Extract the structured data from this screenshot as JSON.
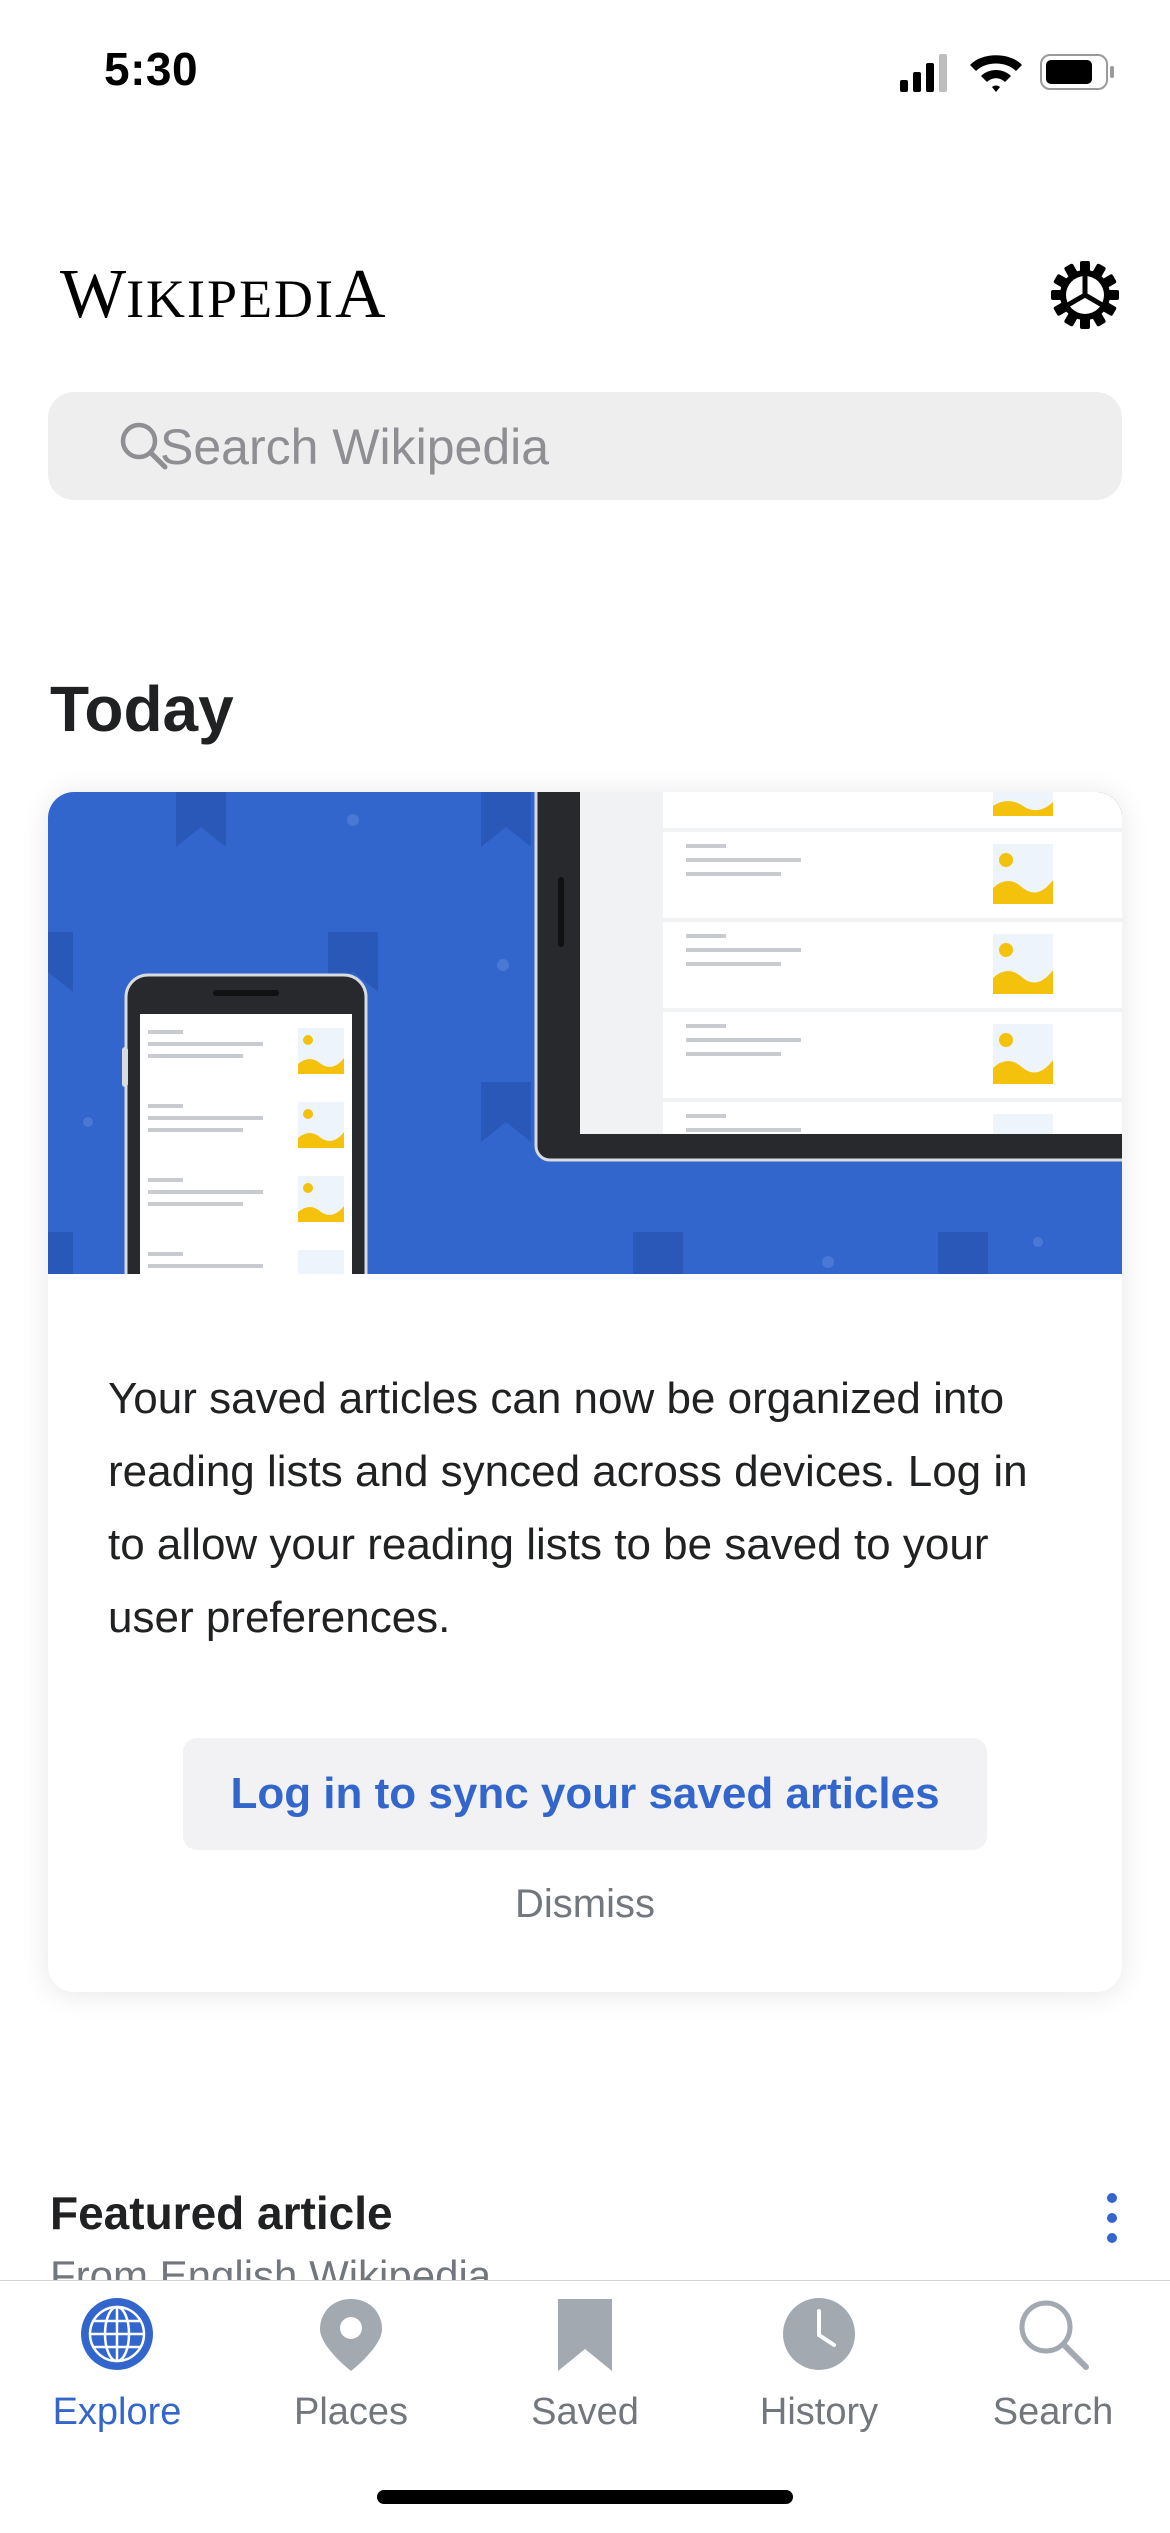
{
  "status_bar": {
    "time": "5:30"
  },
  "header": {
    "wordmark_big_w": "W",
    "wordmark_rest_1": "IKIPEDI",
    "wordmark_big_a": "A"
  },
  "search": {
    "placeholder": "Search Wikipedia"
  },
  "sections": {
    "today": "Today"
  },
  "card": {
    "body": "Your saved articles can now be organized into reading lists and synced across devices. Log in to allow your reading lists to be saved to your user preferences.",
    "login_button": "Log in to sync your saved articles",
    "dismiss": "Dismiss"
  },
  "featured": {
    "title": "Featured article",
    "subtitle": "From English Wikipedia"
  },
  "tabs": [
    {
      "label": "Explore",
      "icon": "globe-icon",
      "active": true
    },
    {
      "label": "Places",
      "icon": "map-pin-icon",
      "active": false
    },
    {
      "label": "Saved",
      "icon": "bookmark-icon",
      "active": false
    },
    {
      "label": "History",
      "icon": "clock-icon",
      "active": false
    },
    {
      "label": "Search",
      "icon": "search-icon",
      "active": false
    }
  ],
  "colors": {
    "accent": "#3366cc",
    "illustration_blue": "#3366cc",
    "text": "#202122",
    "secondary_text": "#72777d"
  }
}
